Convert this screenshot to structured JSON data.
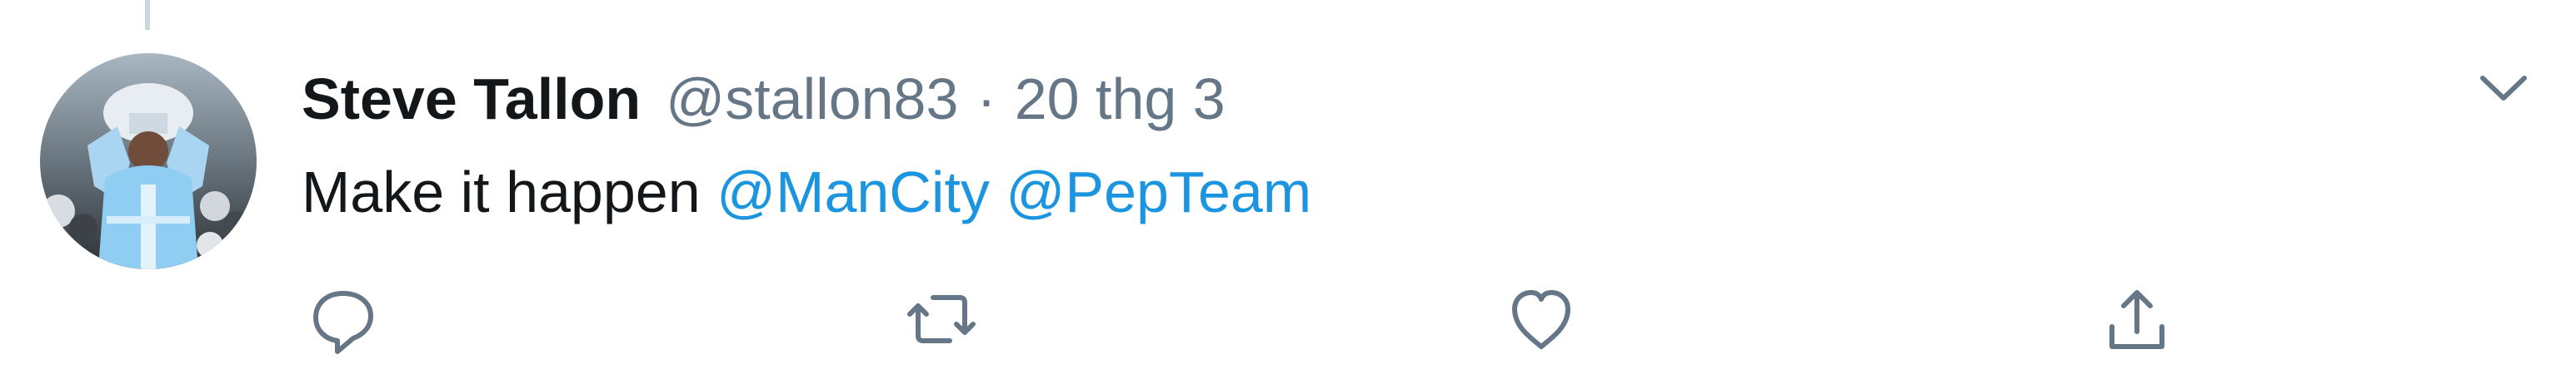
{
  "tweet": {
    "author": {
      "display_name": "Steve Tallon",
      "handle": "@stallon83"
    },
    "separator": "·",
    "timestamp": "20 thg 3",
    "text": "Make it happen",
    "mentions": [
      "@ManCity",
      "@PepTeam"
    ],
    "actions": {
      "reply_icon": "reply-icon",
      "retweet_icon": "retweet-icon",
      "like_icon": "like-icon",
      "share_icon": "share-icon"
    },
    "menu_icon": "chevron-down-icon"
  },
  "colors": {
    "name_text": "#14171a",
    "secondary_text": "#657786",
    "mention_link": "#1b95e0",
    "icon": "#657786",
    "thread_line": "#ccd6dd"
  }
}
